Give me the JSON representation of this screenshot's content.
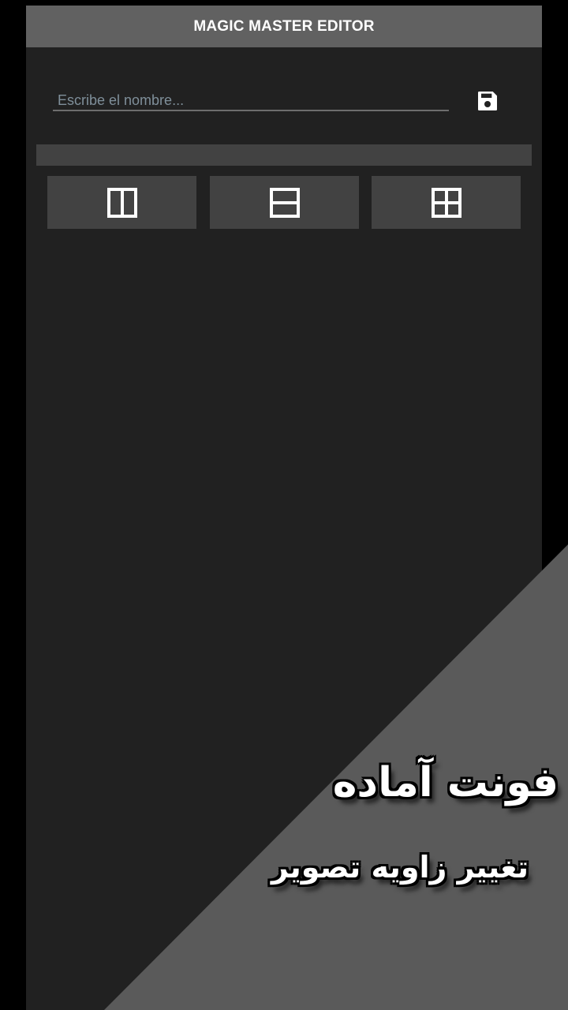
{
  "app": {
    "title": "MAGIC MASTER EDITOR"
  },
  "name_field": {
    "placeholder": "Escribe el nombre...",
    "value": ""
  },
  "toolbar": {
    "save_icon": "save-icon"
  },
  "layout_buttons": [
    {
      "icon": "split-vertical-icon"
    },
    {
      "icon": "split-horizontal-icon"
    },
    {
      "icon": "grid-four-icon"
    }
  ],
  "promo": {
    "line1": "فونت آماده",
    "line2": "تغییر زاویه تصویر"
  },
  "colors": {
    "background": "#000000",
    "screen": "#212121",
    "topbar": "#616161",
    "button": "#424242",
    "overlay_triangle": "#5a5a5a"
  }
}
